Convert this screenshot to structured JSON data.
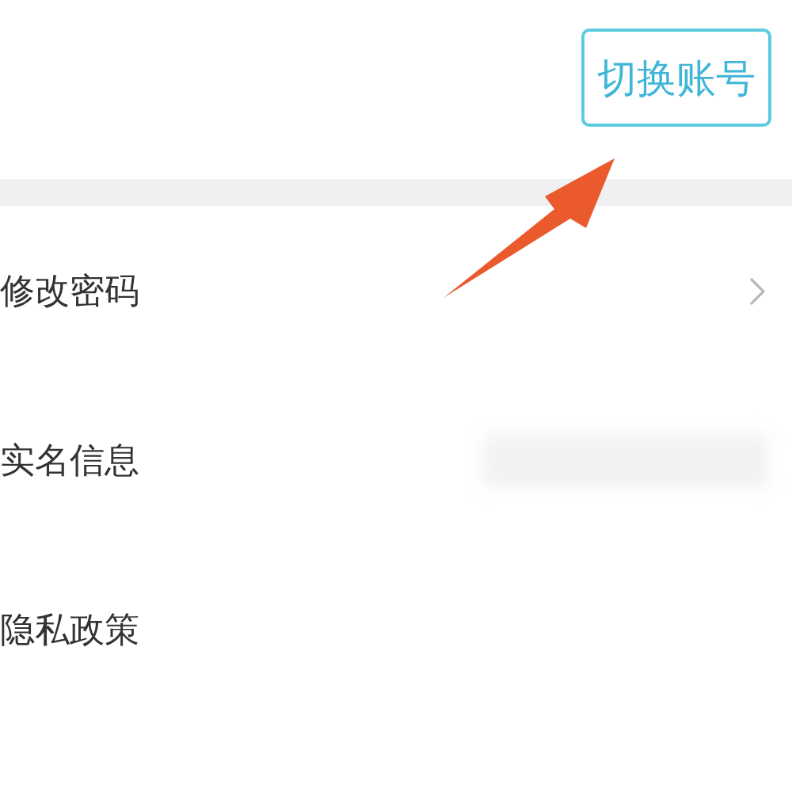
{
  "header": {
    "switch_account_button": "切换账号"
  },
  "rows": [
    {
      "label": "修改密码",
      "kind": "chevron"
    },
    {
      "label": "实名信息",
      "kind": "blurred"
    },
    {
      "label": "隐私政策",
      "kind": "plain"
    }
  ],
  "annotation": {
    "kind": "arrow"
  }
}
